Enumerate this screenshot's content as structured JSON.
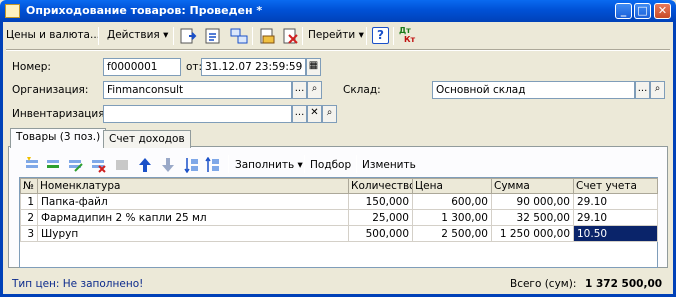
{
  "window": {
    "title": "Оприходование товаров: Проведен *",
    "min": "_",
    "max": "□",
    "close": "✕"
  },
  "toolbar": {
    "prices_label": "Цены и валюта...",
    "actions_label": "Действия",
    "goto_label": "Перейти",
    "help_label": "?",
    "dtkt_label_dt": "Дт",
    "dtkt_label_kt": "Кт",
    "dropdown_arrow": "▾"
  },
  "form": {
    "number_label": "Номер:",
    "number_value": "f0000001",
    "date_label": "от:",
    "date_value": "31.12.07 23:59:59",
    "org_label": "Организация:",
    "org_value": "Finmanconsult",
    "warehouse_label": "Склад:",
    "warehouse_value": "Основной склад",
    "inventory_label": "Инвентаризация:",
    "inventory_value": "",
    "select_btn": "...",
    "open_btn": "⌕",
    "clear_btn": "✕",
    "calendar_btn": "▦"
  },
  "tabs": [
    {
      "label": "Товары (3 поз.)",
      "active": true
    },
    {
      "label": "Счет доходов",
      "active": false
    }
  ],
  "grid_toolbar": {
    "fill_label": "Заполнить",
    "selection_label": "Подбор",
    "change_label": "Изменить"
  },
  "table": {
    "columns": [
      "№",
      "Номенклатура",
      "Количество",
      "Цена",
      "Сумма",
      "Счет учета"
    ],
    "rows": [
      {
        "n": "1",
        "name": "Папка-файл",
        "qty": "150,000",
        "price": "600,00",
        "sum": "90 000,00",
        "account": "29.10"
      },
      {
        "n": "2",
        "name": "Фармадипин 2 % капли 25 мл",
        "qty": "25,000",
        "price": "1 300,00",
        "sum": "32 500,00",
        "account": "29.10"
      },
      {
        "n": "3",
        "name": "Шуруп",
        "qty": "500,000",
        "price": "2 500,00",
        "sum": "1 250 000,00",
        "account": "10.50"
      }
    ]
  },
  "status": {
    "price_type": "Тип цен: Не заполнено!",
    "total_label": "Всего (сум):",
    "total_value": "1 372 500,00"
  },
  "colors": {
    "titlebar": "#0a5ae4",
    "selection": "#0a246a",
    "frame": "#0041b8"
  }
}
